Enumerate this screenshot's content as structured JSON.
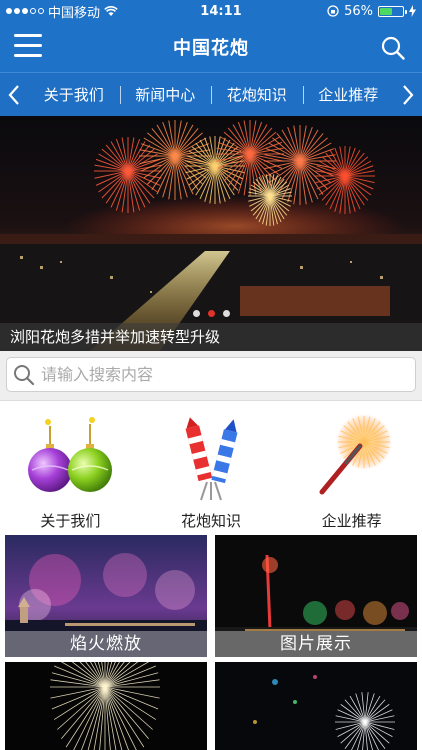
{
  "status_bar": {
    "carrier": "中国移动",
    "time": "14:11",
    "battery_percent": "56%",
    "battery_level": 0.56
  },
  "nav": {
    "title": "中国花炮"
  },
  "categories": {
    "items": [
      "关于我们",
      "新闻中心",
      "花炮知识",
      "企业推荐"
    ]
  },
  "banner": {
    "caption": "浏阳花炮多措并举加速转型升级",
    "slide_count": 3,
    "active_slide": 2
  },
  "search": {
    "placeholder": "请输入搜索内容",
    "value": ""
  },
  "quick_links": [
    {
      "label": "关于我们",
      "icon": "ornament-balls-icon"
    },
    {
      "label": "花炮知识",
      "icon": "firecracker-rockets-icon"
    },
    {
      "label": "企业推荐",
      "icon": "sparkler-icon"
    }
  ],
  "tiles": [
    {
      "label": "焰火燃放"
    },
    {
      "label": "图片展示"
    },
    {
      "label": ""
    },
    {
      "label": ""
    }
  ],
  "colors": {
    "primary": "#1e72c8",
    "active_dot": "#e0322b"
  }
}
